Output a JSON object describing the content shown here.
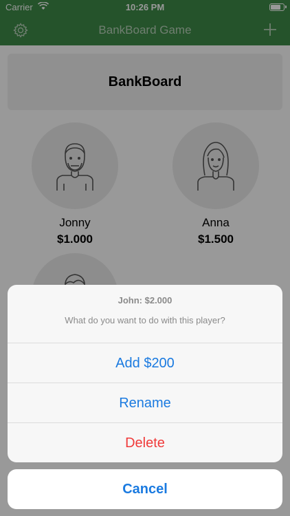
{
  "status_bar": {
    "carrier": "Carrier",
    "time": "10:26 PM"
  },
  "nav": {
    "title": "BankBoard Game",
    "left_icon": "gear-icon",
    "right_icon": "plus-icon"
  },
  "header": {
    "title": "BankBoard"
  },
  "players": [
    {
      "name": "Jonny",
      "balance": "$1.000",
      "avatar": "man-bearded-icon"
    },
    {
      "name": "Anna",
      "balance": "$1.500",
      "avatar": "woman-icon"
    },
    {
      "name": "John",
      "balance": "$2.000",
      "avatar": "man-icon"
    }
  ],
  "action_sheet": {
    "title": "John: $2.000",
    "message": "What do you want to do with this player?",
    "actions": [
      {
        "label": "Add $200",
        "style": "default"
      },
      {
        "label": "Rename",
        "style": "default"
      },
      {
        "label": "Delete",
        "style": "destructive"
      }
    ],
    "cancel_label": "Cancel"
  },
  "colors": {
    "nav_green": "#3f8a48",
    "action_blue": "#1a7ae0",
    "destructive_red": "#f03a3a"
  }
}
